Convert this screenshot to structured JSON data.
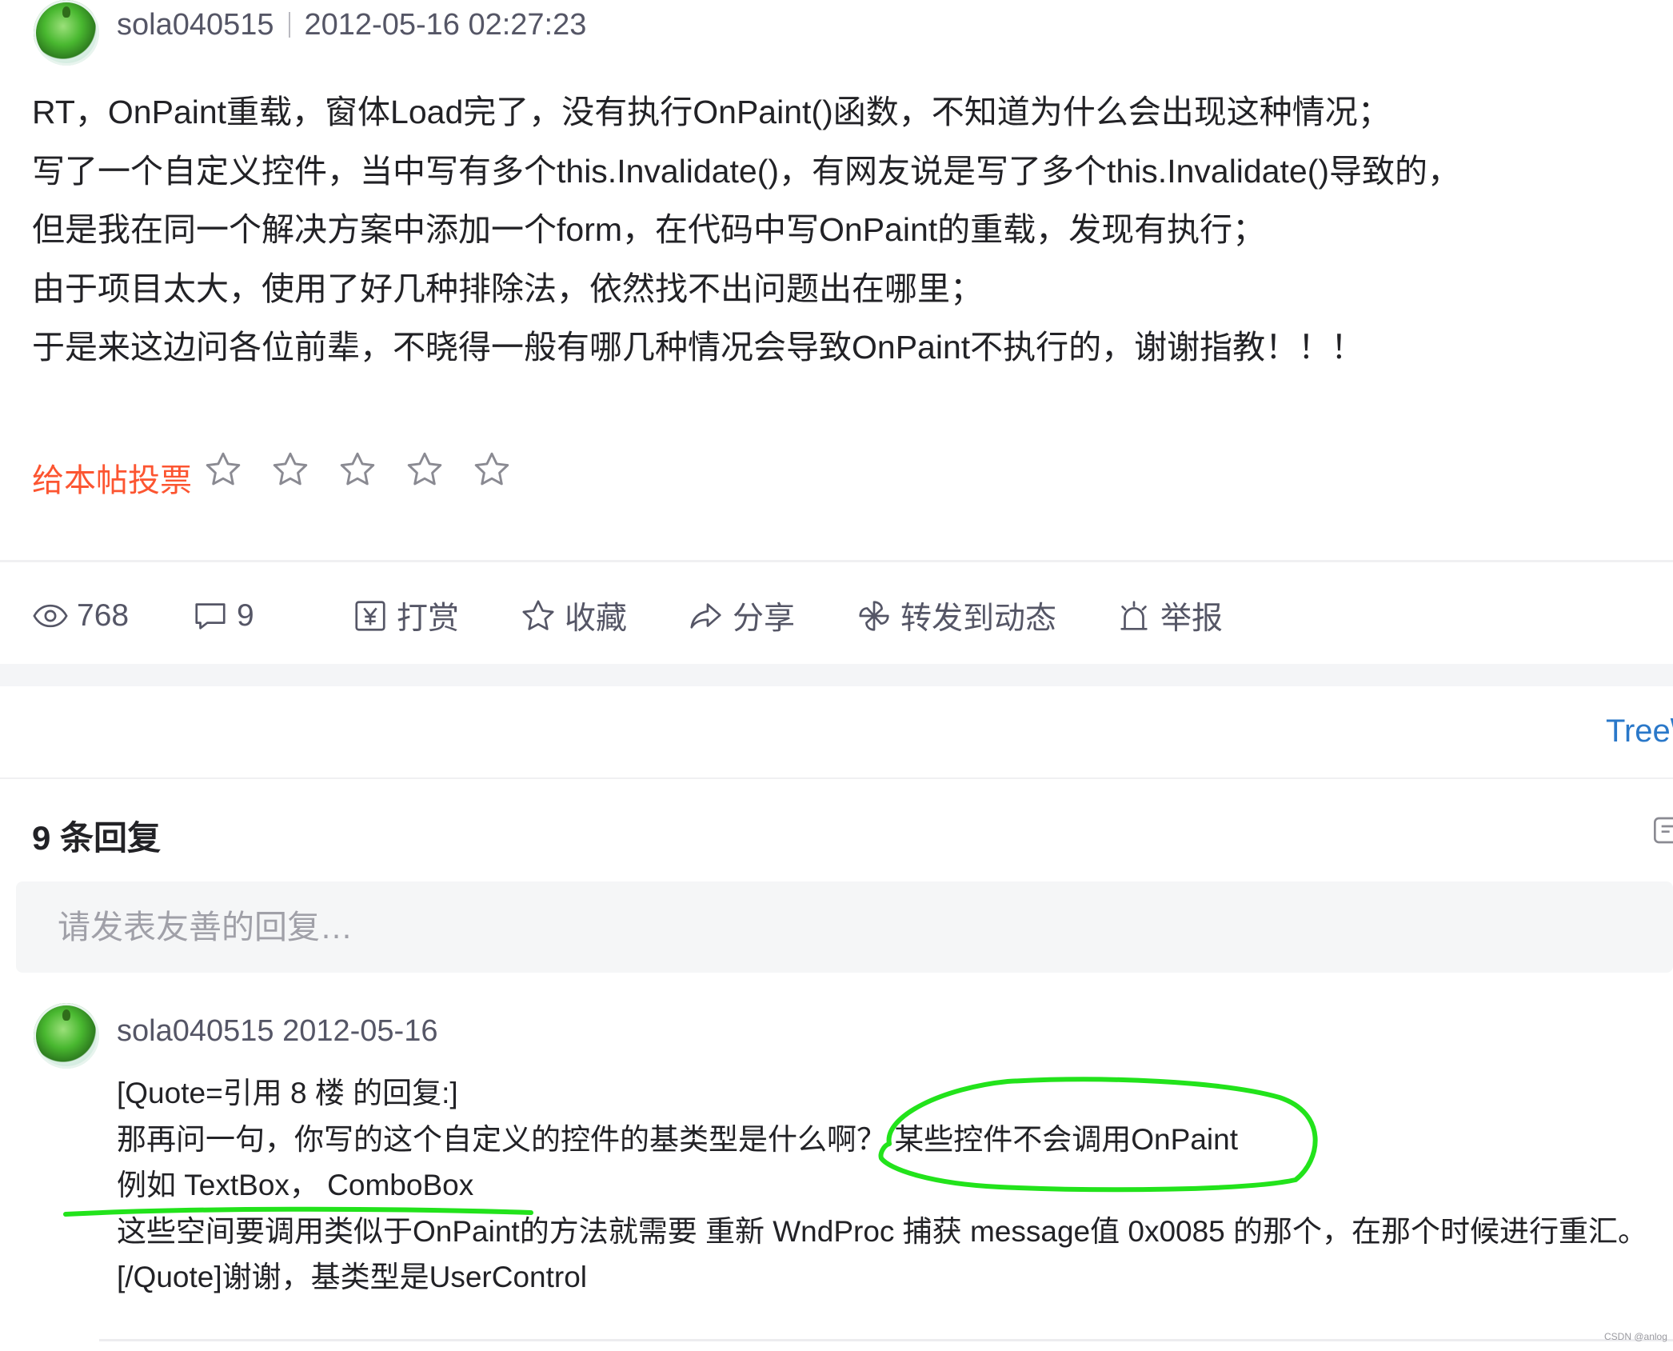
{
  "post": {
    "author": "sola040515",
    "datetime": "2012-05-16 02:27:23",
    "lines": [
      "RT，OnPaint重载，窗体Load完了，没有执行OnPaint()函数，不知道为什么会出现这种情况；",
      "写了一个自定义控件，当中写有多个this.Invalidate()，有网友说是写了多个this.Invalidate()导致的，",
      "但是我在同一个解决方案中添加一个form，在代码中写OnPaint的重载，发现有执行；",
      "由于项目太大，使用了好几种排除法，依然找不出问题出在哪里；",
      "于是来这边问各位前辈，不晓得一般有哪几种情况会导致OnPaint不执行的，谢谢指教！！！"
    ],
    "vote_label": "给本帖投票",
    "star_count": 5
  },
  "actions": {
    "views": "768",
    "comments": "9",
    "reward": "打赏",
    "favorite": "收藏",
    "share": "分享",
    "repost": "转发到动态",
    "report": "举报"
  },
  "related": {
    "link_text": "Tree\\"
  },
  "replies": {
    "heading": "9 条回复",
    "input_placeholder": "请发表友善的回复…",
    "items": [
      {
        "author": "sola040515",
        "date": "2012-05-16",
        "lines": [
          "[Quote=引用 8 楼 的回复:]",
          "那再问一句，你写的这个自定义的控件的基类型是什么啊？ 某些控件不会调用OnPaint",
          "例如 TextBox， ComboBox",
          "这些空间要调用类似于OnPaint的方法就需要 重新 WndProc 捕获 message值 0x0085 的那个，在那个时候进行重汇。",
          "[/Quote]谢谢，基类型是UserControl"
        ]
      }
    ]
  },
  "watermark": "CSDN @anlog",
  "annotation_color": "#22e31b"
}
